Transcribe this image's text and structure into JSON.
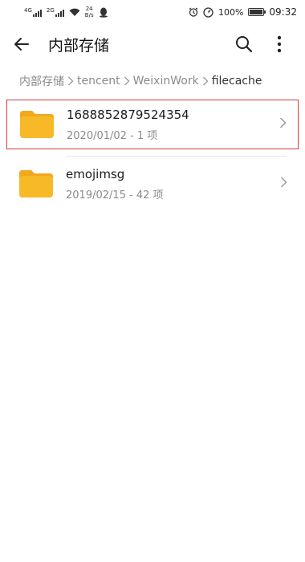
{
  "status_bar": {
    "net1": "4G",
    "net2": "2G",
    "speed_value": "24",
    "speed_unit": "B/s",
    "battery_text": "100%",
    "battery_level": 1.0,
    "time": "09:32"
  },
  "app_bar": {
    "title": "内部存储"
  },
  "breadcrumb": [
    {
      "label": "内部存储"
    },
    {
      "label": "tencent"
    },
    {
      "label": "WeixinWork"
    },
    {
      "label": "filecache"
    }
  ],
  "files": [
    {
      "name": "1688852879524354",
      "meta": "2020/01/02 - 1 项"
    },
    {
      "name": "emojimsg",
      "meta": "2019/02/15 - 42 项"
    }
  ],
  "colors": {
    "folder": "#f7b928",
    "folder_tab": "#f2a81d",
    "highlight_border": "#d83a3a",
    "secondary_text": "#8a8a8a"
  }
}
